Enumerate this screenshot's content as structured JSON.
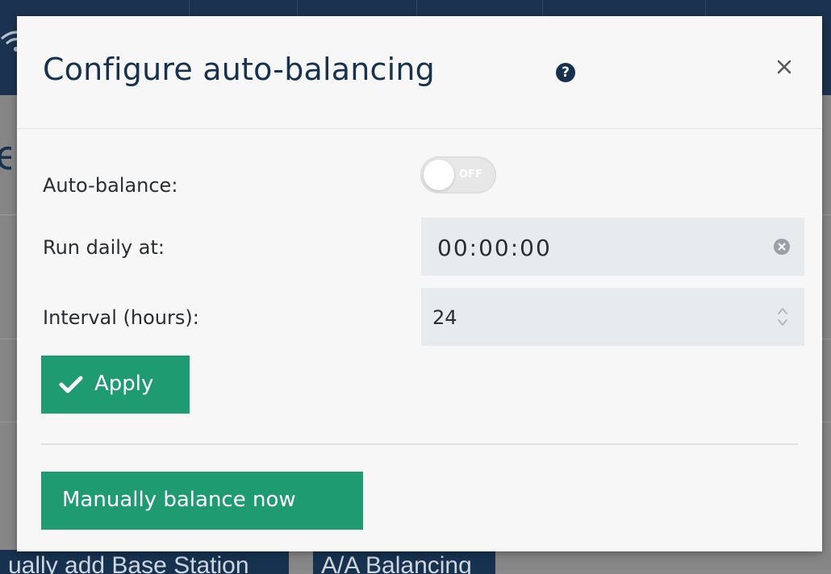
{
  "background": {
    "bottom_buttons": [
      "ually add Base Station",
      "A/A Balancing"
    ]
  },
  "modal": {
    "title": "Configure auto-balancing",
    "help_icon_glyph": "?",
    "close_icon": "close-icon",
    "fields": {
      "auto_balance": {
        "label": "Auto-balance:",
        "toggle_state": "OFF"
      },
      "run_daily": {
        "label": "Run daily at:",
        "value": "00:00:00"
      },
      "interval": {
        "label": "Interval (hours):",
        "value": "24"
      }
    },
    "apply_label": "Apply",
    "manual_label": "Manually balance now"
  },
  "colors": {
    "primary_navy": "#16324f",
    "accent_green": "#1e9b70",
    "input_bg": "#e8ebee",
    "toggle_off": "#e7e7e7"
  }
}
